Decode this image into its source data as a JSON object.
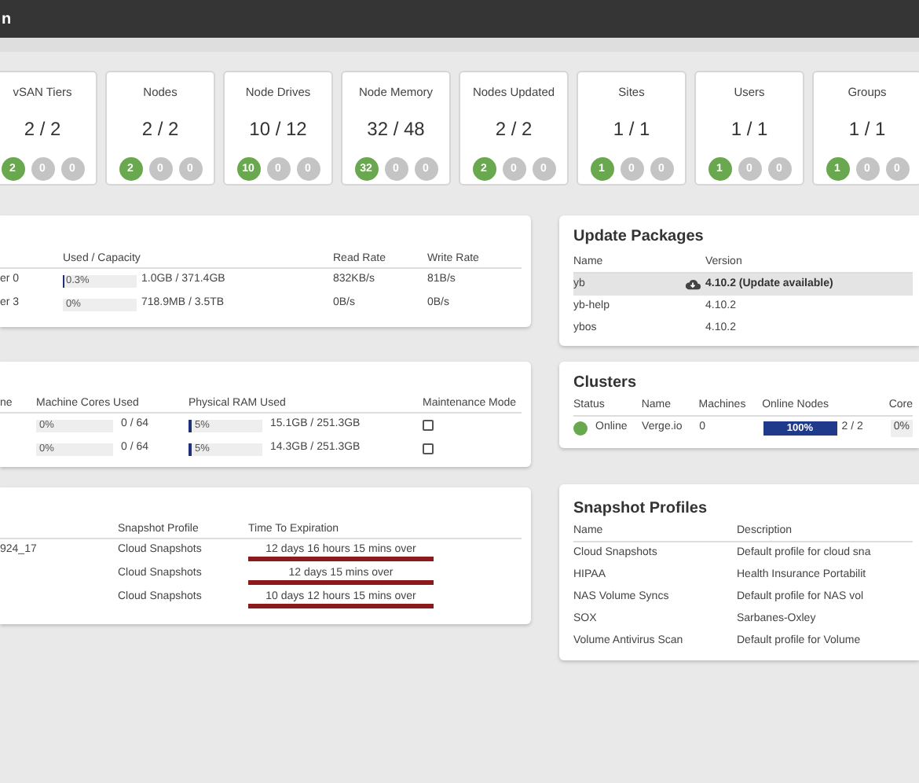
{
  "title_bar": {
    "title": "n"
  },
  "stat_cards": [
    {
      "label": "vSAN Tiers",
      "value": "2 / 2",
      "badges": [
        {
          "count": "2",
          "highlighted": true
        },
        {
          "count": "0",
          "highlighted": false
        },
        {
          "count": "0",
          "highlighted": false
        }
      ]
    },
    {
      "label": "Nodes",
      "value": "2 / 2",
      "badges": [
        {
          "count": "2",
          "highlighted": true
        },
        {
          "count": "0",
          "highlighted": false
        },
        {
          "count": "0",
          "highlighted": false
        }
      ]
    },
    {
      "label": "Node Drives",
      "value": "10 / 12",
      "badges": [
        {
          "count": "10",
          "highlighted": true
        },
        {
          "count": "0",
          "highlighted": false
        },
        {
          "count": "0",
          "highlighted": false
        }
      ]
    },
    {
      "label": "Node Memory",
      "value": "32 / 48",
      "badges": [
        {
          "count": "32",
          "highlighted": true
        },
        {
          "count": "0",
          "highlighted": false
        },
        {
          "count": "0",
          "highlighted": false
        }
      ]
    },
    {
      "label": "Nodes Updated",
      "value": "2 / 2",
      "badges": [
        {
          "count": "2",
          "highlighted": true
        },
        {
          "count": "0",
          "highlighted": false
        },
        {
          "count": "0",
          "highlighted": false
        }
      ]
    },
    {
      "label": "Sites",
      "value": "1 / 1",
      "badges": [
        {
          "count": "1",
          "highlighted": true
        },
        {
          "count": "0",
          "highlighted": false
        },
        {
          "count": "0",
          "highlighted": false
        }
      ]
    },
    {
      "label": "Users",
      "value": "1 / 1",
      "badges": [
        {
          "count": "1",
          "highlighted": true
        },
        {
          "count": "0",
          "highlighted": false
        },
        {
          "count": "0",
          "highlighted": false
        }
      ]
    },
    {
      "label": "Groups",
      "value": "1 / 1",
      "badges": [
        {
          "count": "1",
          "highlighted": true
        },
        {
          "count": "0",
          "highlighted": false
        },
        {
          "count": "0",
          "highlighted": false
        }
      ]
    }
  ],
  "vsan_tiers": {
    "columns": [
      "Used / Capacity",
      "Read Rate",
      "Write Rate"
    ],
    "rows": [
      {
        "column_1": "er 0",
        "used": {
          "percent": "0.3%",
          "level": 0.003
        },
        "capacity": "1.0GB / 371.4GB",
        "read_rate": "832KB/s",
        "write_rate": "81B/s"
      },
      {
        "column_1": "er 3",
        "used": {
          "percent": "0%",
          "level": 0
        },
        "capacity": "718.9MB / 3.5TB",
        "read_rate": "0B/s",
        "write_rate": "0B/s"
      }
    ]
  },
  "nodes": {
    "columns": [
      "ne",
      "Machine Cores Used",
      "Physical RAM Used",
      "Maintenance Mode"
    ],
    "rows": [
      {
        "cores": {
          "percent": "0%",
          "level": 0,
          "reading": "0 / 64"
        },
        "ram": {
          "percent": "5%",
          "level": 0.05,
          "reading": "15.1GB / 251.3GB"
        },
        "maintenance_mode": false
      },
      {
        "cores": {
          "percent": "0%",
          "level": 0,
          "reading": "0 / 64"
        },
        "ram": {
          "percent": "5%",
          "level": 0.05,
          "reading": "14.3GB / 251.3GB"
        },
        "maintenance_mode": false
      }
    ]
  },
  "snapshots": {
    "columns": [
      "Snapshot Profile",
      "Time To Expiration"
    ],
    "rows": [
      {
        "column_1": "924_17",
        "profile": "Cloud Snapshots",
        "expiration": "12 days 16 hours 15 mins over"
      },
      {
        "profile": "Cloud Snapshots",
        "expiration": "12 days 15 mins over"
      },
      {
        "profile": "Cloud Snapshots",
        "expiration": "10 days 12 hours 15 mins over"
      }
    ]
  },
  "update_packages": {
    "title": "Update Packages",
    "columns": [
      "Name",
      "Version"
    ],
    "rows": [
      {
        "name": "yb",
        "version": "4.10.2 (Update available)",
        "update_available": true
      },
      {
        "name": "yb-help",
        "version": "4.10.2",
        "update_available": false
      },
      {
        "name": "ybos",
        "version": "4.10.2",
        "update_available": false
      }
    ]
  },
  "clusters": {
    "title": "Clusters",
    "columns": [
      "Status",
      "Name",
      "Machines",
      "Online Nodes",
      "Core"
    ],
    "rows": [
      {
        "status": "Online",
        "color": "#6aa84f",
        "name": "Verge.io",
        "machines": "0",
        "online_nodes": {
          "percent": "100%",
          "level": 1,
          "reading": "2 / 2"
        },
        "cores": "0%"
      }
    ]
  },
  "snapshot_profiles": {
    "title": "Snapshot Profiles",
    "columns": [
      "Name",
      "Description"
    ],
    "rows": [
      {
        "name": "Cloud Snapshots",
        "description": "Default profile for cloud sna"
      },
      {
        "name": "HIPAA",
        "description": "Health Insurance Portabilit"
      },
      {
        "name": "NAS Volume Syncs",
        "description": "Default profile for NAS vol"
      },
      {
        "name": "SOX",
        "description": "Sarbanes-Oxley"
      },
      {
        "name": "Volume Antivirus Scan",
        "description": "Default profile for Volume"
      }
    ]
  }
}
